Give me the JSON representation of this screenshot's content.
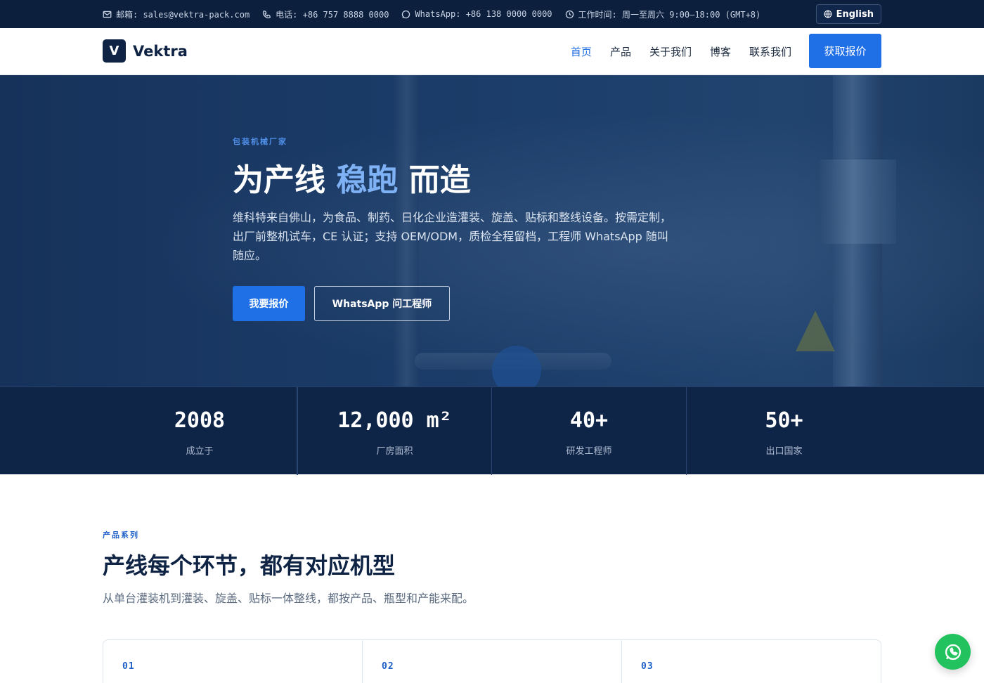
{
  "topbar": {
    "email": "邮箱: sales@vektra-pack.com",
    "phone": "电话: +86 757 8888 0000",
    "whatsapp": "WhatsApp: +86 138 0000 0000",
    "hours": "工作时间: 周一至周六 9:00–18:00 (GMT+8)",
    "language": "English"
  },
  "header": {
    "logo_mark": "V",
    "logo_text": "Vektra",
    "nav": [
      "首页",
      "产品",
      "关于我们",
      "博客",
      "联系我们"
    ],
    "cta": "获取报价"
  },
  "hero": {
    "eyebrow": "包装机械厂家",
    "title_pre": "为产线 ",
    "title_highlight": "稳跑",
    "title_post": " 而造",
    "description": "维科特来自佛山，为食品、制药、日化企业造灌装、旋盖、贴标和整线设备。按需定制，出厂前整机试车，CE 认证；支持 OEM/ODM，质检全程留档，工程师 WhatsApp 随叫随应。",
    "primary_button": "我要报价",
    "secondary_button": "WhatsApp 问工程师"
  },
  "stats": [
    {
      "value": "2008",
      "label": "成立于"
    },
    {
      "value": "12,000 m²",
      "label": "厂房面积"
    },
    {
      "value": "40+",
      "label": "研发工程师"
    },
    {
      "value": "50+",
      "label": "出口国家"
    }
  ],
  "products": {
    "eyebrow": "产品系列",
    "title": "产线每个环节，都有对应机型",
    "subtitle": "从单台灌装机到灌装、旋盖、贴标一体整线，都按产品、瓶型和产能来配。",
    "cards": [
      {
        "number": "01"
      },
      {
        "number": "02"
      },
      {
        "number": "03"
      }
    ]
  },
  "colors": {
    "navy": "#0c1f3d",
    "accent": "#1f6fe6",
    "highlight": "#7fb1f5",
    "whatsapp_green": "#22c35e"
  }
}
